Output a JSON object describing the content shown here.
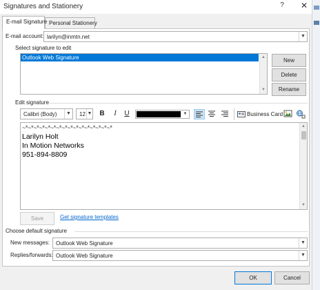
{
  "window": {
    "title": "Signatures and Stationery",
    "help": "?",
    "close": "✕"
  },
  "tabs": [
    "E-mail Signature",
    "Personal Stationery"
  ],
  "email_account": {
    "label": "E-mail account:",
    "value": "larilyn@inmtn.net"
  },
  "select_signature": {
    "label": "Select signature to edit",
    "items": [
      "Outlook Web Signature"
    ],
    "new_btn": "New",
    "delete_btn": "Delete",
    "rename_btn": "Rename"
  },
  "edit_signature": {
    "label": "Edit signature",
    "font": "Calibri (Body)",
    "size": "12",
    "bold": "B",
    "italic": "I",
    "underline": "U",
    "color_hex": "#000000",
    "business_card": "Business Card",
    "content": {
      "separator": "~*~*~*~*~*~*~*~*~*~*~*~*~*~*~*~*",
      "lines": [
        "Larilyn Holt",
        "In Motion Networks",
        "951-894-8809"
      ]
    },
    "save_btn": "Save",
    "templates_link": "Get signature templates"
  },
  "defaults": {
    "label": "Choose default signature",
    "new_messages_label": "New messages:",
    "new_messages_value": "Outlook Web Signature",
    "replies_label": "Replies/forwards:",
    "replies_value": "Outlook Web Signature"
  },
  "footer": {
    "ok": "OK",
    "cancel": "Cancel"
  }
}
